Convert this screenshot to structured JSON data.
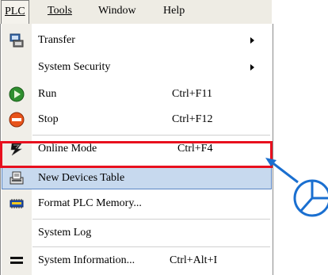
{
  "menubar": {
    "items": [
      {
        "label": "PLC",
        "active": true
      },
      {
        "label": "Tools",
        "active": false
      },
      {
        "label": "Window",
        "active": false
      },
      {
        "label": "Help",
        "active": false
      }
    ]
  },
  "menu": {
    "items": [
      {
        "label": "Transfer",
        "shortcut": "",
        "submenu": true,
        "icon": "transfer-icon"
      },
      {
        "label": "System Security",
        "shortcut": "",
        "submenu": true,
        "icon": ""
      },
      {
        "label": "Run",
        "shortcut": "Ctrl+F11",
        "submenu": false,
        "icon": "run-icon"
      },
      {
        "label": "Stop",
        "shortcut": "Ctrl+F12",
        "submenu": false,
        "icon": "stop-icon"
      },
      {
        "label": "Online Mode",
        "shortcut": "Ctrl+F4",
        "submenu": false,
        "icon": "online-mode-icon"
      },
      {
        "label": "New Devices Table",
        "shortcut": "",
        "submenu": false,
        "icon": "devices-table-icon",
        "highlighted": true
      },
      {
        "label": "Format PLC Memory...",
        "shortcut": "",
        "submenu": false,
        "icon": "memory-icon"
      },
      {
        "label": "System Log",
        "shortcut": "",
        "submenu": false,
        "icon": ""
      },
      {
        "label": "System Information...",
        "shortcut": "Ctrl+Alt+I",
        "submenu": false,
        "icon": "system-info-icon"
      }
    ]
  },
  "colors": {
    "highlight_frame": "#e8101e",
    "callout_arrow": "#1a6fd0",
    "selection_bg": "#c7d9ee"
  }
}
